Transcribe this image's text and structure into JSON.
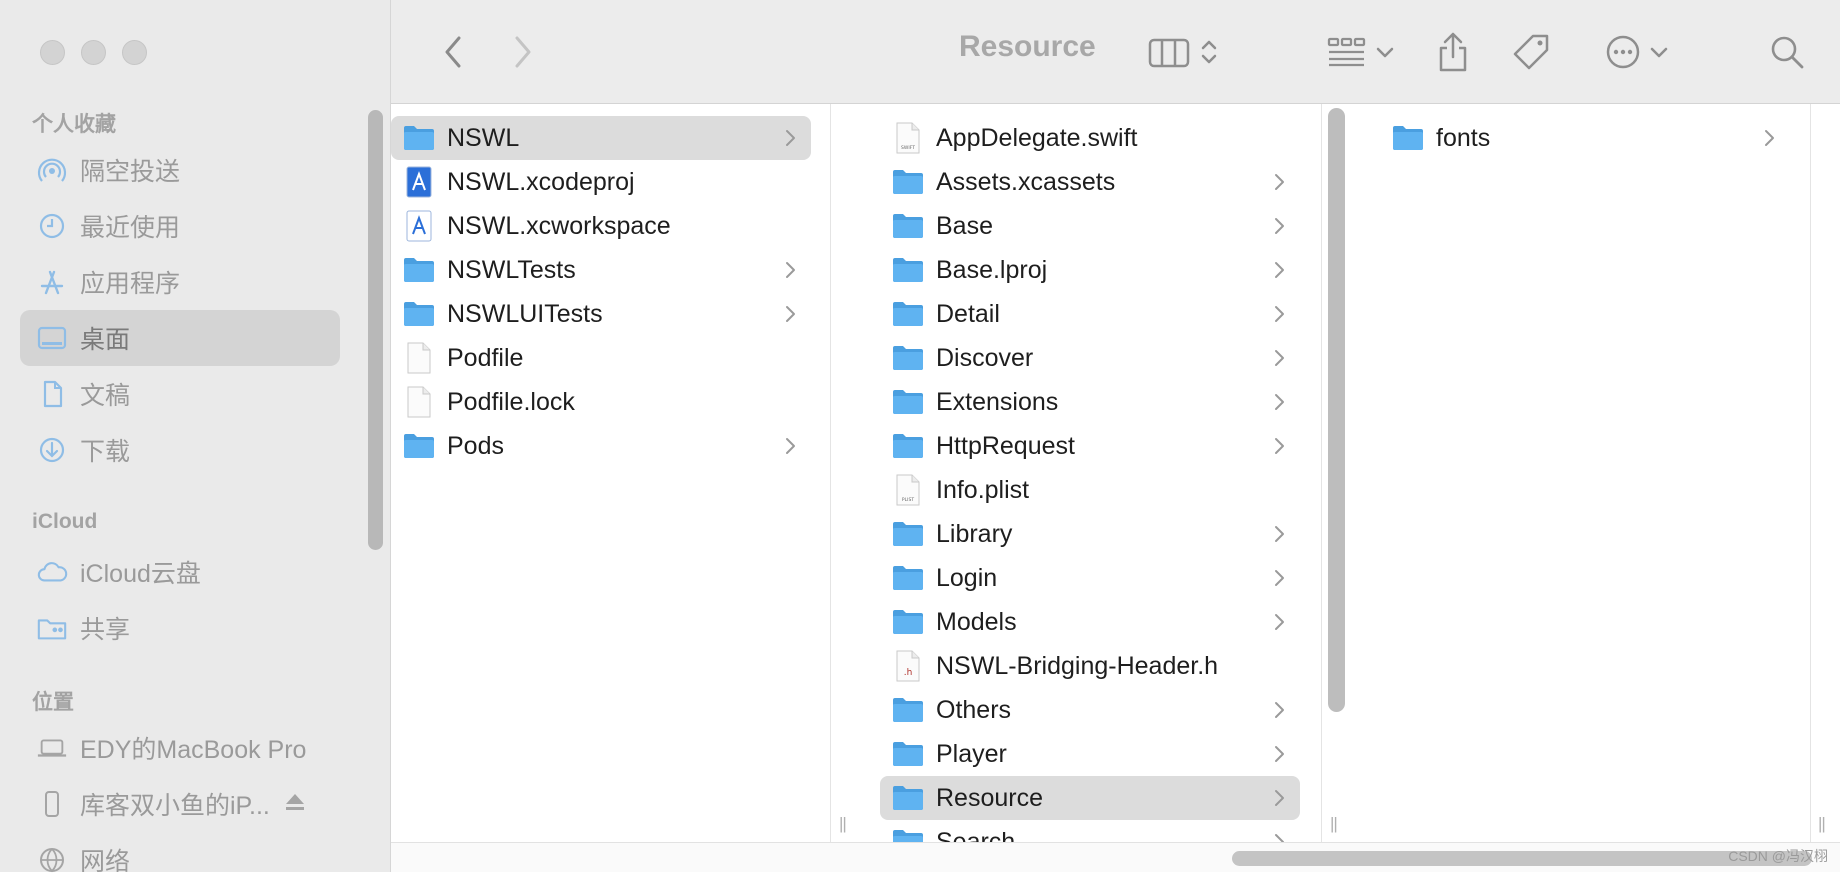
{
  "toolbar": {
    "title": "Resource"
  },
  "sidebar": {
    "sections": [
      {
        "heading": "个人收藏",
        "items": [
          {
            "label": "隔空投送",
            "icon": "airdrop-icon"
          },
          {
            "label": "最近使用",
            "icon": "clock-icon"
          },
          {
            "label": "应用程序",
            "icon": "applications-icon"
          },
          {
            "label": "桌面",
            "icon": "desktop-icon",
            "selected": true
          },
          {
            "label": "文稿",
            "icon": "document-icon"
          },
          {
            "label": "下载",
            "icon": "download-icon"
          }
        ]
      },
      {
        "heading": "iCloud",
        "items": [
          {
            "label": "iCloud云盘",
            "icon": "cloud-icon"
          },
          {
            "label": "共享",
            "icon": "shared-folder-icon"
          }
        ]
      },
      {
        "heading": "位置",
        "items": [
          {
            "label": "EDY的MacBook Pro",
            "icon": "laptop-icon"
          },
          {
            "label": "库客双小鱼的iP...",
            "icon": "iphone-icon"
          },
          {
            "label": "网络",
            "icon": "network-icon"
          }
        ]
      }
    ]
  },
  "columns": [
    {
      "items": [
        {
          "name": "NSWL",
          "type": "folder",
          "hasChildren": true,
          "selected": true
        },
        {
          "name": "NSWL.xcodeproj",
          "type": "xcodeproj"
        },
        {
          "name": "NSWL.xcworkspace",
          "type": "xcworkspace"
        },
        {
          "name": "NSWLTests",
          "type": "folder",
          "hasChildren": true
        },
        {
          "name": "NSWLUITests",
          "type": "folder",
          "hasChildren": true
        },
        {
          "name": "Podfile",
          "type": "file"
        },
        {
          "name": "Podfile.lock",
          "type": "file"
        },
        {
          "name": "Pods",
          "type": "folder",
          "hasChildren": true
        }
      ]
    },
    {
      "items": [
        {
          "name": "AppDelegate.swift",
          "type": "swift"
        },
        {
          "name": "Assets.xcassets",
          "type": "folder",
          "hasChildren": true
        },
        {
          "name": "Base",
          "type": "folder",
          "hasChildren": true
        },
        {
          "name": "Base.lproj",
          "type": "folder",
          "hasChildren": true
        },
        {
          "name": "Detail",
          "type": "folder",
          "hasChildren": true
        },
        {
          "name": "Discover",
          "type": "folder",
          "hasChildren": true
        },
        {
          "name": "Extensions",
          "type": "folder",
          "hasChildren": true
        },
        {
          "name": "HttpRequest",
          "type": "folder",
          "hasChildren": true
        },
        {
          "name": "Info.plist",
          "type": "plist"
        },
        {
          "name": "Library",
          "type": "folder",
          "hasChildren": true
        },
        {
          "name": "Login",
          "type": "folder",
          "hasChildren": true
        },
        {
          "name": "Models",
          "type": "folder",
          "hasChildren": true
        },
        {
          "name": "NSWL-Bridging-Header.h",
          "type": "header"
        },
        {
          "name": "Others",
          "type": "folder",
          "hasChildren": true
        },
        {
          "name": "Player",
          "type": "folder",
          "hasChildren": true
        },
        {
          "name": "Resource",
          "type": "folder",
          "hasChildren": true,
          "selected": true
        },
        {
          "name": "Search",
          "type": "folder",
          "hasChildren": true
        }
      ]
    },
    {
      "items": [
        {
          "name": "fonts",
          "type": "folder",
          "hasChildren": true
        }
      ]
    }
  ],
  "file_icon_tags": {
    "swift": "SWIFT",
    "plist": "PLIST",
    "header": ".h"
  },
  "watermark": "CSDN @冯汉栩",
  "colors": {
    "folder": "#5fb3f1",
    "folder_tab": "#4a9fe0",
    "selection": "#dcdcdc",
    "sidebar_bg": "#eaeaea"
  }
}
